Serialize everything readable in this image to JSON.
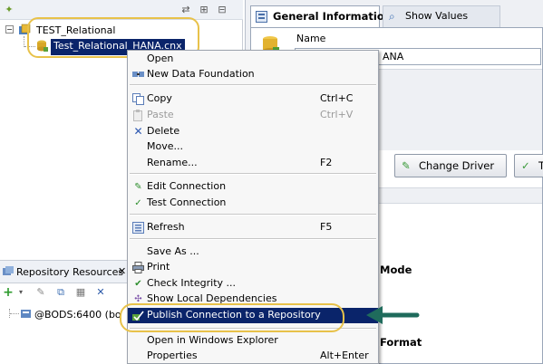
{
  "explorer": {
    "tree": {
      "root_label": "TEST_Relational",
      "child_label": "Test_Relational_HANA.cnx",
      "root_expander": "−"
    }
  },
  "repository": {
    "tab_label": "Repository Resources",
    "tab_close": "✕",
    "session_label": "@BODS:6400 (bo"
  },
  "editor": {
    "tabs": [
      {
        "label": "General Information"
      },
      {
        "label": "Show Values"
      }
    ],
    "name_label": "Name",
    "name_value_partial": "ANA",
    "buttons": {
      "change_driver": "Change Driver",
      "test_partial": "Te"
    },
    "section_mode_partial": "Mode",
    "section_format_partial": "Format"
  },
  "context_menu": {
    "items": [
      {
        "label": "Open",
        "shortcut": "",
        "icon": "none",
        "enabled": true
      },
      {
        "label": "New Data Foundation",
        "shortcut": "",
        "icon": "data-foundation-icon",
        "enabled": true
      },
      {
        "label": "Copy",
        "shortcut": "Ctrl+C",
        "icon": "copy-icon",
        "enabled": true
      },
      {
        "label": "Paste",
        "shortcut": "Ctrl+V",
        "icon": "paste-icon",
        "enabled": false
      },
      {
        "label": "Delete",
        "shortcut": "",
        "icon": "delete-icon",
        "enabled": true
      },
      {
        "label": "Move...",
        "shortcut": "",
        "icon": "none",
        "enabled": true
      },
      {
        "label": "Rename...",
        "shortcut": "F2",
        "icon": "none",
        "enabled": true
      },
      {
        "label": "Edit Connection",
        "shortcut": "",
        "icon": "edit-connection-icon",
        "enabled": true
      },
      {
        "label": "Test Connection",
        "shortcut": "",
        "icon": "test-connection-icon",
        "enabled": true
      },
      {
        "label": "Refresh",
        "shortcut": "F5",
        "icon": "refresh-icon",
        "enabled": true
      },
      {
        "label": "Save As ...",
        "shortcut": "",
        "icon": "none",
        "enabled": true
      },
      {
        "label": "Print",
        "shortcut": "",
        "icon": "print-icon",
        "enabled": true
      },
      {
        "label": "Check Integrity ...",
        "shortcut": "",
        "icon": "check-integrity-icon",
        "enabled": true
      },
      {
        "label": "Show Local Dependencies",
        "shortcut": "",
        "icon": "dependencies-icon",
        "enabled": true
      },
      {
        "label": "Publish Connection to a Repository",
        "shortcut": "",
        "icon": "publish-icon",
        "enabled": true,
        "highlighted": true
      },
      {
        "label": "Open in Windows Explorer",
        "shortcut": "",
        "icon": "none",
        "enabled": true
      },
      {
        "label": "Properties",
        "shortcut": "Alt+Enter",
        "icon": "none",
        "enabled": true
      }
    ]
  },
  "colors": {
    "menu_highlight": "#0a246a",
    "callout": "#e8c24a",
    "arrow": "#1f6b5c"
  }
}
